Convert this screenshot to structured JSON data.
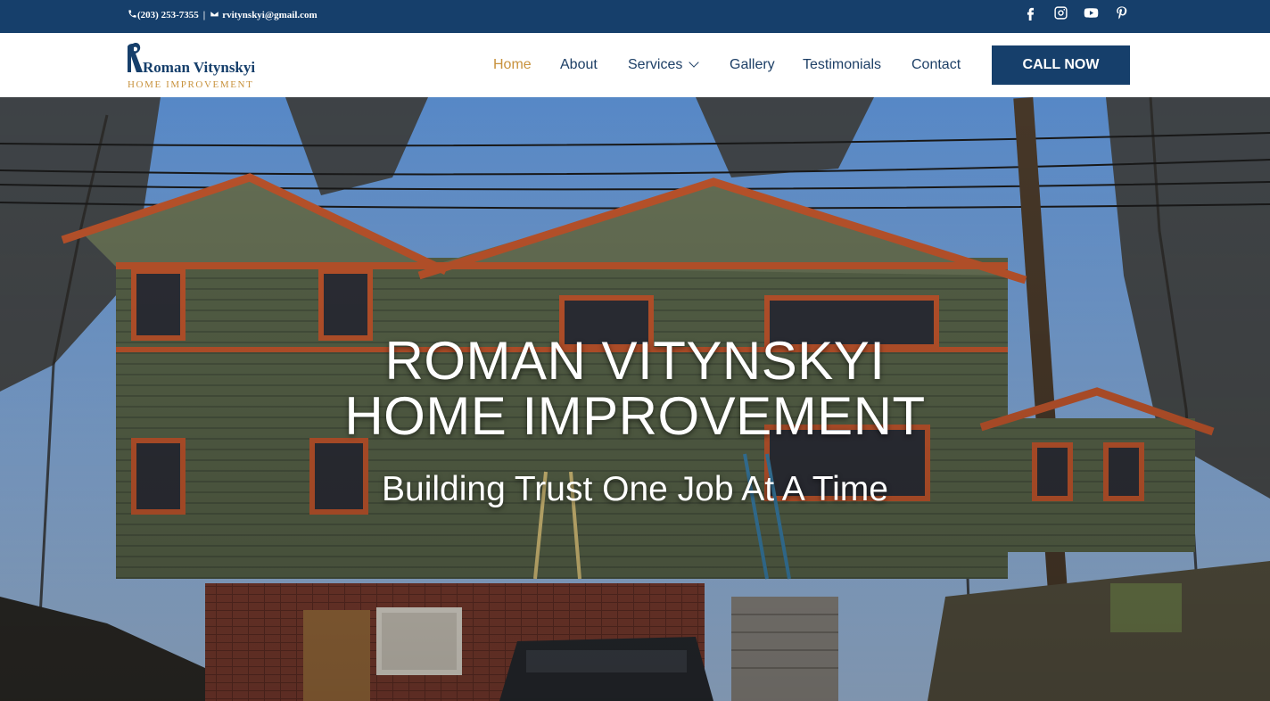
{
  "topbar": {
    "phone": "(203) 253-7355",
    "separator": "|",
    "email": "rvitynskyi@gmail.com",
    "social_icons": [
      "facebook-icon",
      "instagram-icon",
      "youtube-icon",
      "pinterest-icon"
    ]
  },
  "logo": {
    "name": "Roman Vitynskyi",
    "tagline": "HOME IMPROVEMENT"
  },
  "nav": {
    "items": [
      {
        "label": "Home",
        "active": true
      },
      {
        "label": "About"
      },
      {
        "label": "Services",
        "has_dropdown": true
      },
      {
        "label": "Gallery"
      },
      {
        "label": "Testimonials"
      },
      {
        "label": "Contact"
      }
    ],
    "cta": "CALL NOW"
  },
  "hero": {
    "title_line1": "ROMAN VITYNSKYI",
    "title_line2": "HOME IMPROVEMENT",
    "subtitle": "Building Trust One Job At A Time"
  },
  "colors": {
    "brand_navy": "#163f6b",
    "accent_gold": "#c8923d",
    "nav_text": "#1d3f66"
  }
}
